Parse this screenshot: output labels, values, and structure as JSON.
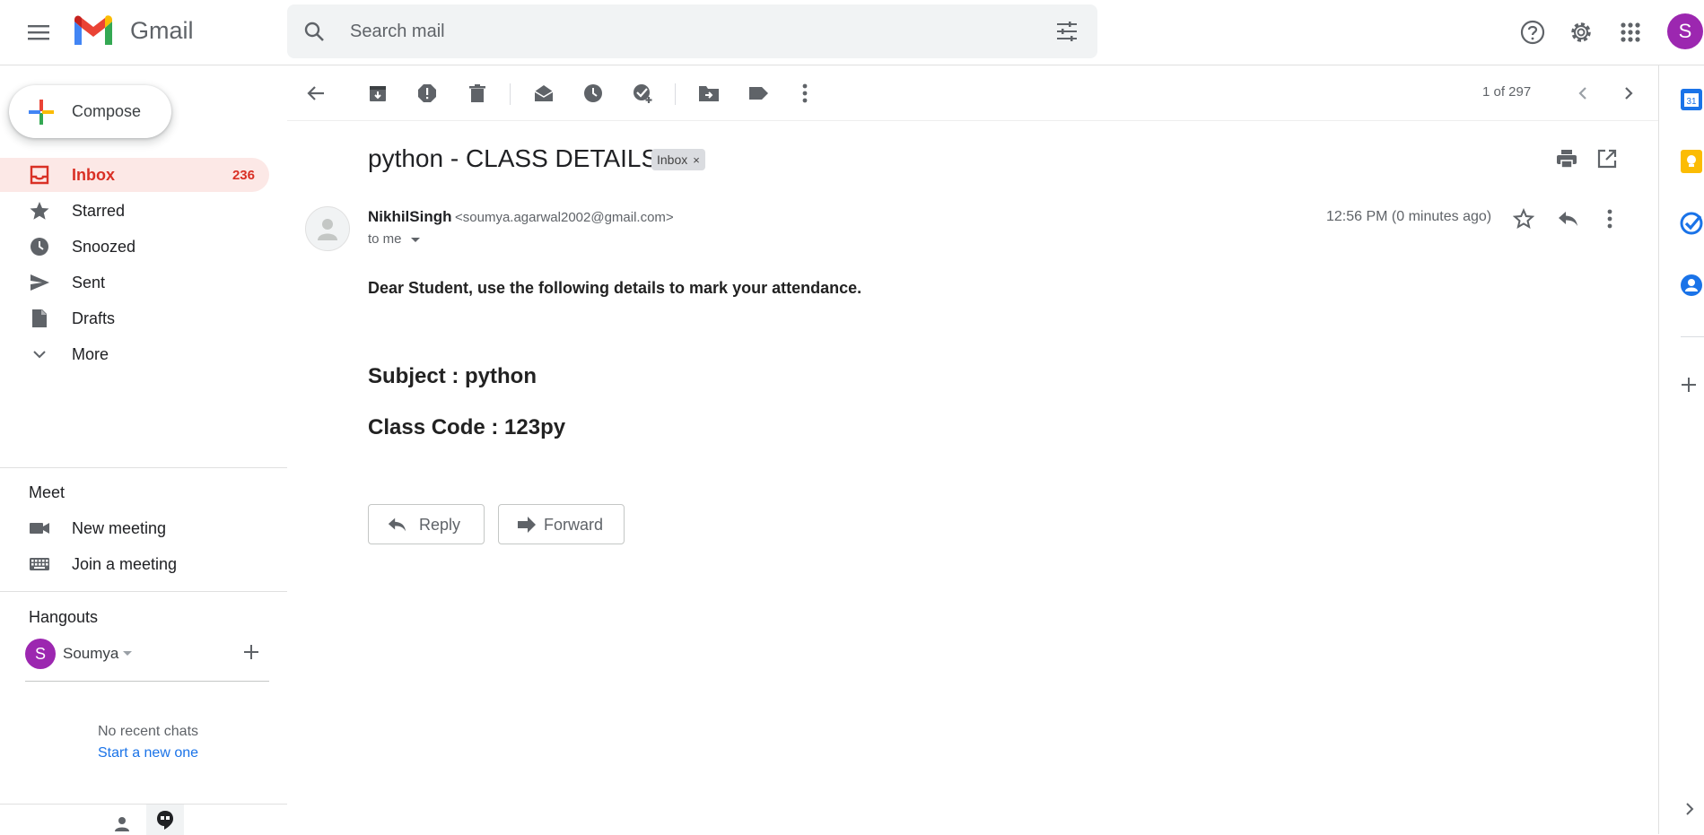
{
  "header": {
    "brand": "Gmail",
    "search_placeholder": "Search mail",
    "avatar_letter": "S"
  },
  "sidebar": {
    "compose_label": "Compose",
    "items": [
      {
        "label": "Inbox",
        "count": "236",
        "icon": "inbox-icon",
        "active": true
      },
      {
        "label": "Starred",
        "icon": "star-icon"
      },
      {
        "label": "Snoozed",
        "icon": "clock-icon"
      },
      {
        "label": "Sent",
        "icon": "send-icon"
      },
      {
        "label": "Drafts",
        "icon": "draft-icon"
      },
      {
        "label": "More",
        "icon": "chevron-down-icon"
      }
    ],
    "meet": {
      "title": "Meet",
      "new_meeting": "New meeting",
      "join_meeting": "Join a meeting"
    },
    "hangouts": {
      "title": "Hangouts",
      "user_initial": "S",
      "user_name": "Soumya",
      "no_chats": "No recent chats",
      "start_new": "Start a new one"
    }
  },
  "toolbar": {
    "pager": "1 of 297"
  },
  "message": {
    "subject": "python - CLASS DETAILS",
    "label_chip": "Inbox",
    "label_chip_close": "×",
    "sender_name": "NikhilSingh",
    "sender_email": "<soumya.agarwal2002@gmail.com>",
    "to": "to me",
    "time": "12:56 PM (0 minutes ago)",
    "body": {
      "line1": "Dear Student, use the following details to mark your attendance.",
      "subject_line": "Subject : python",
      "code_line": "Class Code : 123py"
    },
    "reply_label": "Reply",
    "forward_label": "Forward"
  },
  "side_panel": {
    "calendar_day": "31"
  },
  "colors": {
    "accent_red": "#d93025",
    "active_bg": "#fce8e6",
    "avatar": "#9c27b0",
    "link_blue": "#1a73e8"
  }
}
